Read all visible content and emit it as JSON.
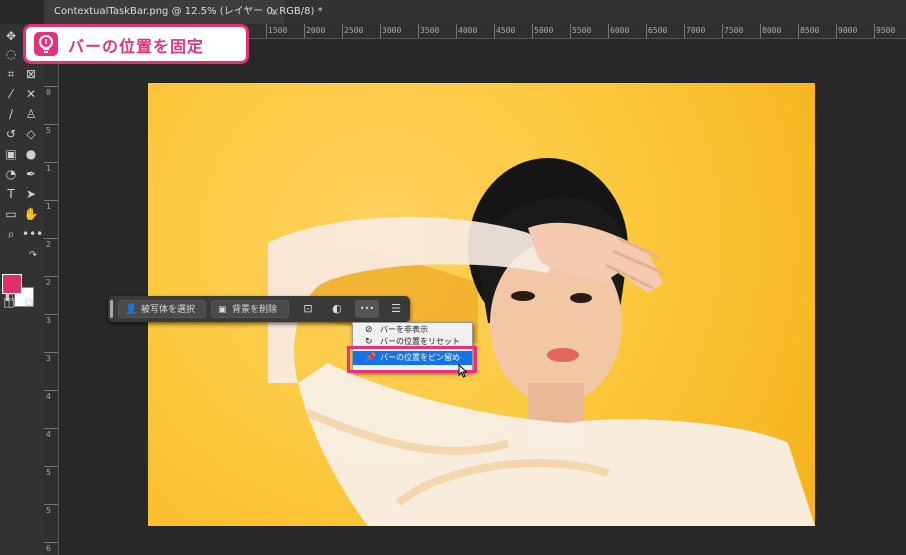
{
  "document": {
    "tab_title": "ContextualTaskBar.png @ 12.5% (レイヤー 0, RGB/8) *",
    "close_glyph": "×"
  },
  "ruler": {
    "horizontal_labels": [
      "1500",
      "2000",
      "2500",
      "3000",
      "3500",
      "4000",
      "4500",
      "5000",
      "5500",
      "6000",
      "6500",
      "7000",
      "7500",
      "8000",
      "8500",
      "9000",
      "9500"
    ],
    "vertical_labels": [
      "0",
      "5",
      "1",
      "1",
      "2",
      "2",
      "3",
      "3",
      "4",
      "4",
      "5",
      "5",
      "6"
    ]
  },
  "toolbox": {
    "tools": [
      "move-icon",
      "lasso-icon",
      "crop-icon",
      "frame-icon",
      "eyedropper-icon",
      "healing-icon",
      "brush-icon",
      "stamp-icon",
      "history-brush-icon",
      "eraser-icon",
      "gradient-icon",
      "blur-icon",
      "dodge-icon",
      "pen-icon",
      "type-icon",
      "path-select-icon",
      "shape-icon",
      "hand-icon",
      "zoom-icon",
      "more-tools-icon"
    ],
    "foreground_color": "#e12f6b",
    "background_color": "#ffffff"
  },
  "callout": {
    "text": "バーの位置を固定",
    "icon": "lightbulb-icon",
    "accent_color": "#e6327a"
  },
  "taskbar": {
    "select_subject_label": "被写体を選択",
    "remove_background_label": "背景を削除",
    "more_glyph": "•••"
  },
  "menu": {
    "items": [
      {
        "label": "バーを非表示",
        "icon": "hide-eye-icon"
      },
      {
        "label": "バーの位置をリセット",
        "icon": "reset-icon"
      },
      {
        "label": "バーの位置をピン留め",
        "icon": "pin-icon",
        "selected": true
      }
    ],
    "selected_color": "#1473e6"
  }
}
